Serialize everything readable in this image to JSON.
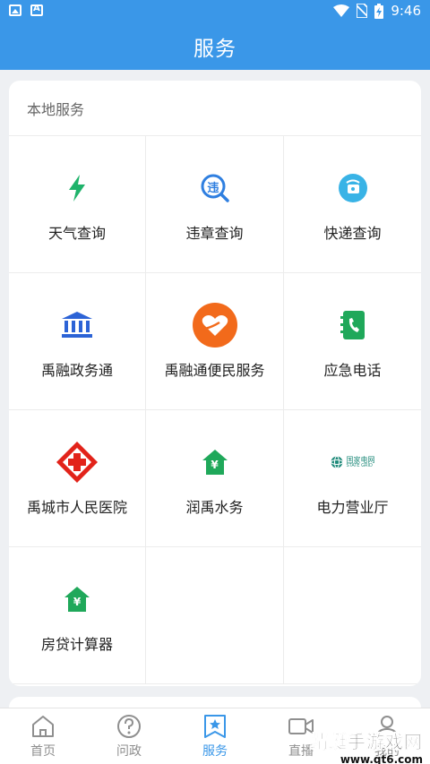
{
  "status_bar": {
    "time": "9:46"
  },
  "header": {
    "title": "服务"
  },
  "section": {
    "title": "本地服务"
  },
  "services": [
    {
      "label": "天气查询",
      "icon": "lightning-icon",
      "color": "#1fb36b"
    },
    {
      "label": "违章查询",
      "icon": "violation-search-icon",
      "color": "#2f7fe0"
    },
    {
      "label": "快递查询",
      "icon": "parcel-icon",
      "color": "#39b3e6"
    },
    {
      "label": "禹融政务通",
      "icon": "government-building-icon",
      "color": "#2c63d6"
    },
    {
      "label": "禹融通便民服务",
      "icon": "heart-hand-icon",
      "color": "#f26a1b"
    },
    {
      "label": "应急电话",
      "icon": "phone-book-icon",
      "color": "#1fa85a"
    },
    {
      "label": "禹城市人民医院",
      "icon": "red-cross-icon",
      "color": "#e2231a"
    },
    {
      "label": "润禹水务",
      "icon": "yuan-house-icon",
      "color": "#1fa85a"
    },
    {
      "label": "电力营业厅",
      "icon": "state-grid-logo",
      "color": "#1f8a7a",
      "logo_text": "国家电网",
      "logo_sub": "STATE GRID"
    },
    {
      "label": "房贷计算器",
      "icon": "yuan-house-icon",
      "color": "#1fa85a"
    }
  ],
  "icon_glyphs": {
    "violation": "违",
    "yuan": "¥"
  },
  "bottom_nav": [
    {
      "label": "首页",
      "icon": "home-icon",
      "active": false
    },
    {
      "label": "问政",
      "icon": "question-icon",
      "active": false
    },
    {
      "label": "服务",
      "icon": "star-bookmark-icon",
      "active": true
    },
    {
      "label": "直播",
      "icon": "video-camera-icon",
      "active": false
    },
    {
      "label": "我的",
      "icon": "user-icon",
      "active": false
    }
  ],
  "colors": {
    "primary": "#3a97e8",
    "inactive": "#8f8f8f"
  },
  "watermark": {
    "text": "蜻蜓手游戏网",
    "url": "www.qt6.com"
  }
}
